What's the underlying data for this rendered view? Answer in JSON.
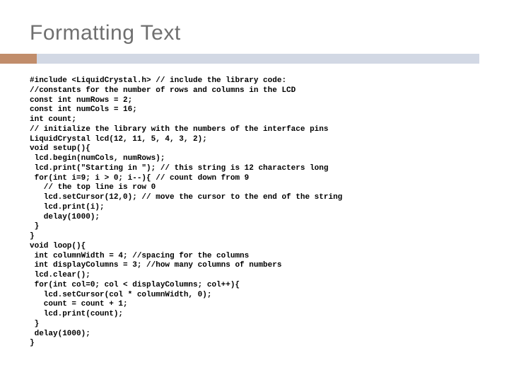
{
  "title": "Formatting Text",
  "code": "#include <LiquidCrystal.h> // include the library code:\n//constants for the number of rows and columns in the LCD\nconst int numRows = 2;\nconst int numCols = 16;\nint count;\n// initialize the library with the numbers of the interface pins\nLiquidCrystal lcd(12, 11, 5, 4, 3, 2);\nvoid setup(){\n lcd.begin(numCols, numRows);\n lcd.print(\"Starting in \"); // this string is 12 characters long\n for(int i=9; i > 0; i--){ // count down from 9\n   // the top line is row 0\n   lcd.setCursor(12,0); // move the cursor to the end of the string\n   lcd.print(i);\n   delay(1000);\n }\n}\nvoid loop(){\n int columnWidth = 4; //spacing for the columns\n int displayColumns = 3; //how many columns of numbers\n lcd.clear();\n for(int col=0; col < displayColumns; col++){\n   lcd.setCursor(col * columnWidth, 0);\n   count = count + 1;\n   lcd.print(count);\n }\n delay(1000);\n}"
}
